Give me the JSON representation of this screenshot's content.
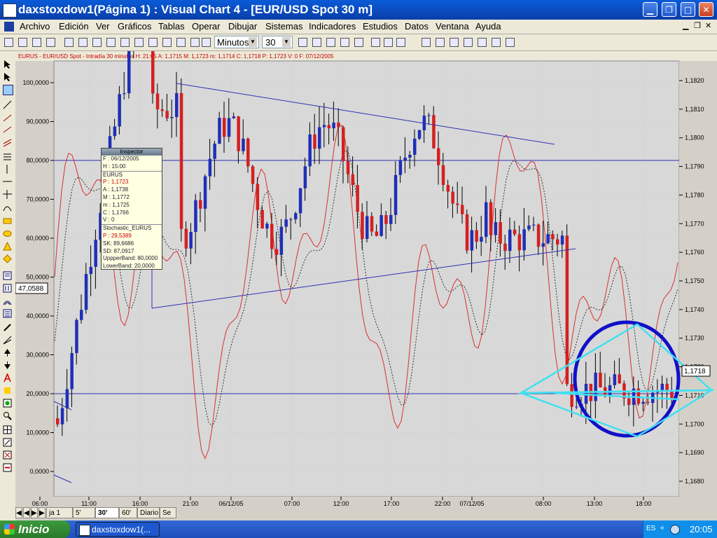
{
  "window": {
    "title": "daxstoxdow1(Página 1) : Visual Chart 4 - [EUR/USD Spot 30 m]"
  },
  "menu": {
    "items": [
      "Archivo",
      "Edición",
      "Ver",
      "Gráficos",
      "Tablas",
      "Operar",
      "Dibujar",
      "Sistemas",
      "Indicadores",
      "Estudios",
      "Datos",
      "Ventana",
      "Ayuda"
    ]
  },
  "toolbar": {
    "timeframe": "Minutos",
    "interval": "30"
  },
  "chart": {
    "header": "EURUS - EUR/USD Spot - Intradía 30 minutos H: 21:05  A: 1,1715  M: 1,1723  m: 1,1714  C: 1,1718  P: 1,1723  V: 0  F: 07/12/2005",
    "left_axis_labels": [
      "100,0000",
      "90,0000",
      "80,0000",
      "70,0000",
      "60,0000",
      "50,0000",
      "40,0000",
      "30,0000",
      "20,0000",
      "10,0000",
      "0,0000"
    ],
    "right_axis_labels": [
      "1,1820",
      "1,1810",
      "1,1800",
      "1,1790",
      "1,1780",
      "1,1770",
      "1,1760",
      "1,1750",
      "1,1740",
      "1,1730",
      "1,1720",
      "1,1710",
      "1,1700",
      "1,1690",
      "1,1680"
    ],
    "current_price_tag": "1,1718",
    "cursor_value_tag": "47,0588",
    "x_axis_labels": [
      "06:00",
      "11:00",
      "16:00",
      "21:00",
      "06/12/05",
      "07:00",
      "12:00",
      "17:00",
      "22:00",
      "07/12/05",
      "08:00",
      "13:00",
      "18:00"
    ],
    "colors": {
      "background": "#d8d8d8",
      "bull": "#1f2fb8",
      "bear": "#d42020",
      "trendline": "#3030b0",
      "stochastic": "#d83030",
      "annotation_circle": "#1010c8",
      "annotation_triangle": "#40e0f0"
    }
  },
  "inspector": {
    "title": "Inspector",
    "rows": [
      "F : 06/12/2005",
      "H : 15:00",
      "EURUS",
      "P : 1,1723",
      "A : 1,1738",
      "M : 1,1772",
      "m : 1,1725",
      "C : 1,1766",
      "V : 0",
      "Stochastic_EURUS",
      "P : 29,5389",
      "SK: 89,6686",
      "SD: 87,0917",
      "UppperBand: 80,0000",
      "LowerBand: 20,0000"
    ]
  },
  "tabs": [
    "ja 1",
    "5'",
    "30'",
    "60'",
    "Diario",
    "Se"
  ],
  "active_tab": "30'",
  "taskbar": {
    "start": "Inicio",
    "task": "daxstoxdow1(...",
    "lang": "ES",
    "clock": "20:05"
  }
}
